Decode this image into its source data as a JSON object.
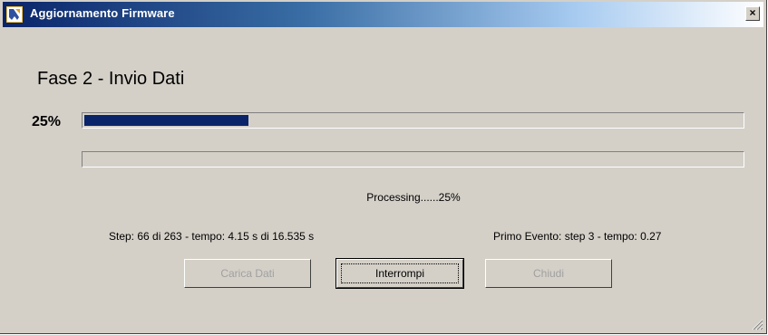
{
  "window": {
    "title": "Aggiornamento Firmware",
    "close_glyph": "×",
    "icon": "firmware-app-icon"
  },
  "phase": {
    "title": "Fase 2 - Invio Dati"
  },
  "progress": {
    "percent_label": "25%",
    "main_fraction": 0.25,
    "sub_fraction": 0.0,
    "fill_color": "#0a246a"
  },
  "status": {
    "processing": "Processing......25%",
    "step": "Step: 66 di 263 - tempo: 4.15 s di 16.535 s",
    "first_event": "Primo Evento: step 3 - tempo: 0.27"
  },
  "buttons": {
    "load": "Carica Dati",
    "stop": "Interrompi",
    "close": "Chiudi"
  }
}
